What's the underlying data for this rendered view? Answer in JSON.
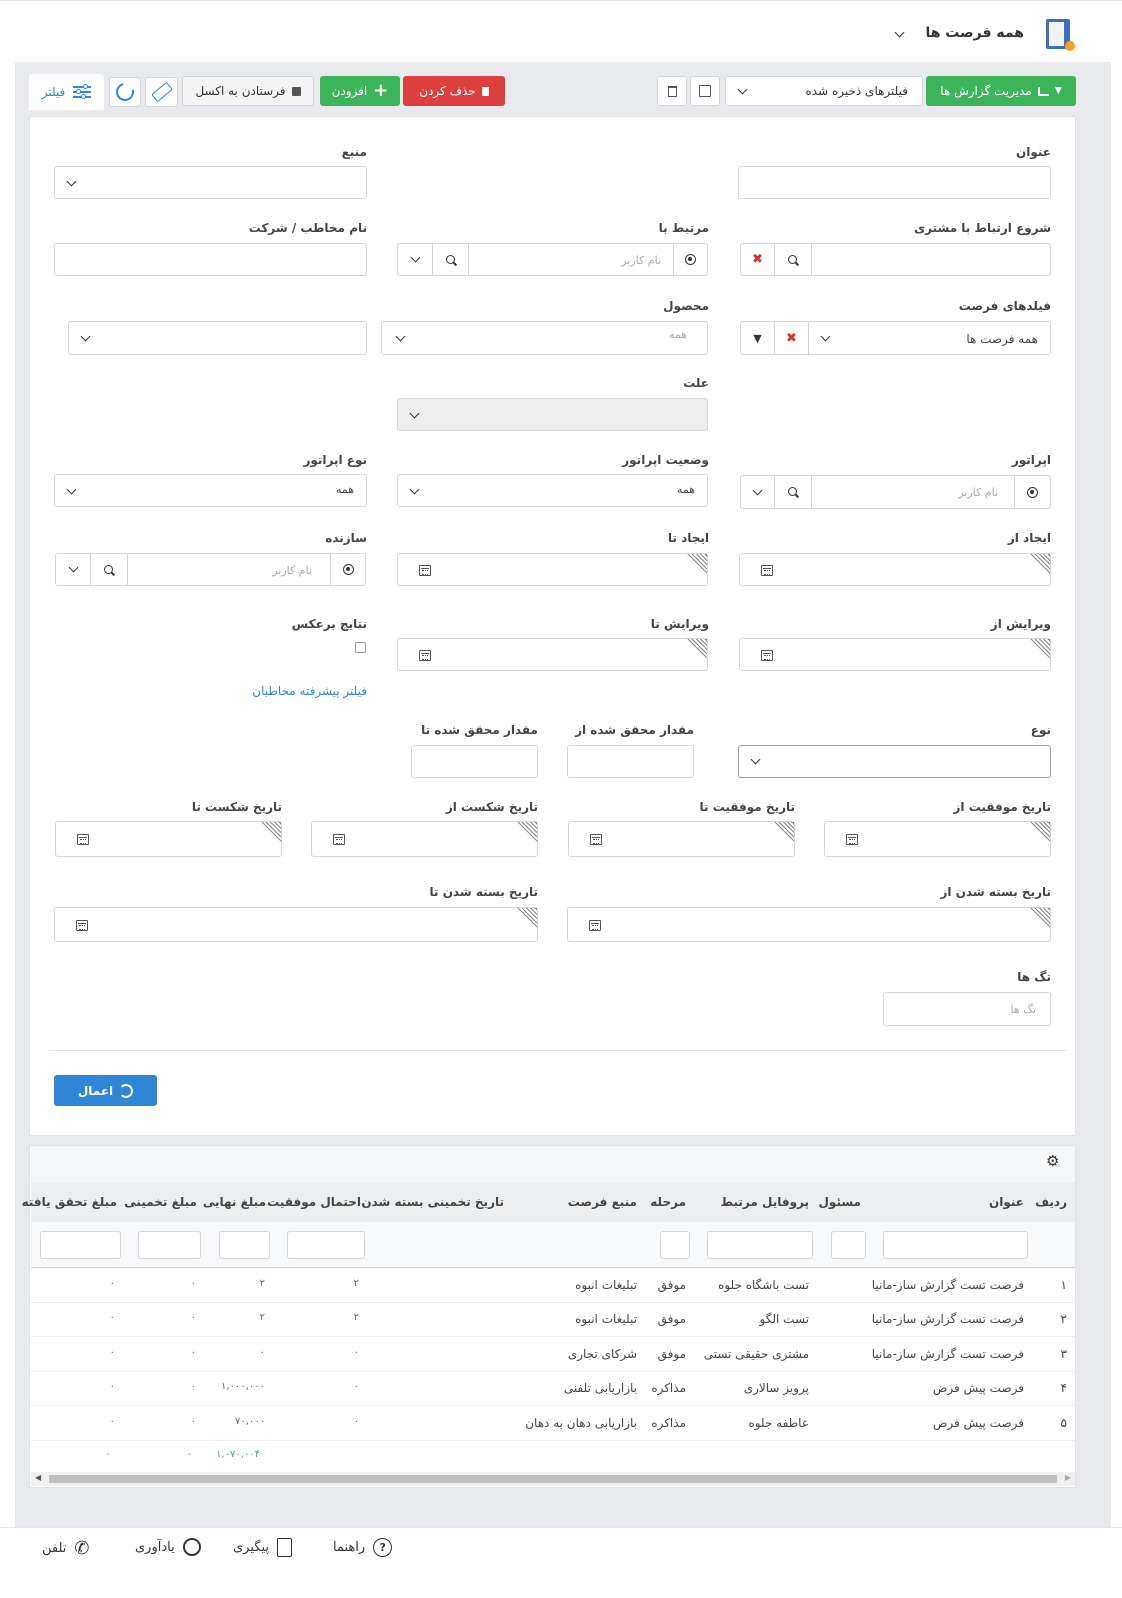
{
  "header": {
    "title": "همه فرصت ها"
  },
  "toolbar": {
    "filter_label": "فیلتر",
    "export_label": "فرستادن به اکسل",
    "add_label": "افزودن",
    "delete_label": "حذف کردن",
    "saved_filters_value": "فیلترهای ذخیره شده",
    "report_manage_label": "مدیریت گزارش ها"
  },
  "form": {
    "title_label": "عنوان",
    "source_label": "منبع",
    "contact_start_label": "شروع ارتباط با مشتری",
    "related_label": "مرتبط با",
    "related_placeholder": "نام کاربر",
    "contact_company_label": "نام مخاطب / شرکت",
    "opp_fields_label": "فیلدهای فرصت",
    "opp_fields_value": "همه فرصت ها",
    "product_label": "محصول",
    "product_value": "همه",
    "reason_label": "علت",
    "operator_label": "اپراتور",
    "operator_placeholder": "نام کاربر",
    "operator_status_label": "وضعیت اپراتور",
    "operator_status_value": "همه",
    "operator_type_label": "نوع اپراتور",
    "operator_type_value": "همه",
    "created_from_label": "ایجاد از",
    "created_to_label": "ایجاد تا",
    "creator_label": "سازنده",
    "creator_placeholder": "نام کاربر",
    "edited_from_label": "ویرایش از",
    "edited_to_label": "ویرایش تا",
    "reverse_label": "نتایج برعکس",
    "advanced_filter_link": "فیلتر پیشرفته مخاطبان",
    "type_label": "نوع",
    "achieved_from_label": "مقدار محقق شده از",
    "achieved_to_label": "مقدار محقق شده تا",
    "success_from_label": "تاریخ موفقیت از",
    "success_to_label": "تاریخ موفقیت تا",
    "fail_from_label": "تاریخ شکست از",
    "fail_to_label": "تاریخ شکست تا",
    "closed_from_label": "تاریخ بسته شدن از",
    "closed_to_label": "تاریخ بسته شدن تا",
    "tags_label": "تگ ها",
    "tags_placeholder": "تگ ها",
    "apply_label": "اعمال"
  },
  "table": {
    "columns": [
      "ردیف",
      "عنوان",
      "مسئول",
      "پروفایل مرتبط",
      "مرحله",
      "منبع فرصت",
      "تاریخ تخمینی بسته شدن",
      "احتمال موفقیت",
      "مبلغ نهایی",
      "مبلغ تخمینی",
      "مبلغ تحقق یافته"
    ],
    "rows": [
      {
        "n": "۱",
        "title": "فرصت تست گزارش ساز-مانیا",
        "owner": "",
        "profile": "تست باشگاه جلوه",
        "stage": "موفق",
        "source": "تبلیغات انبوه",
        "date": "",
        "prob": "۲",
        "final": "۲",
        "est": "۰",
        "realized": "۰"
      },
      {
        "n": "۲",
        "title": "فرصت تست گزارش ساز-مانیا",
        "owner": "",
        "profile": "تست الگو",
        "stage": "موفق",
        "source": "تبلیغات انبوه",
        "date": "",
        "prob": "۲",
        "final": "۲",
        "est": "۰",
        "realized": "۰"
      },
      {
        "n": "۳",
        "title": "فرصت تست گزارش ساز-مانیا",
        "owner": "",
        "profile": "مشتری حقیقی تستی",
        "stage": "موفق",
        "source": "شرکای تجاری",
        "date": "",
        "prob": "۰",
        "final": "۰",
        "est": "۰",
        "realized": "۰"
      },
      {
        "n": "۴",
        "title": "فرصت پیش فرض",
        "owner": "",
        "profile": "پرویز سالاری",
        "stage": "مذاکره",
        "source": "بازاریابی تلفنی",
        "date": "",
        "prob": "۰",
        "final": "۱,۰۰۰,۰۰۰",
        "est": "۰",
        "realized": "۰"
      },
      {
        "n": "۵",
        "title": "فرصت پیش فرض",
        "owner": "",
        "profile": "عاطفه جلوه",
        "stage": "مذاکره",
        "source": "بازاریابی دهان به دهان",
        "date": "",
        "prob": "۰",
        "final": "۷۰,۰۰۰",
        "est": "۰",
        "realized": "۰"
      }
    ],
    "totals": {
      "final": "۱,۰۷۰,۰۰۴",
      "est": "۰",
      "realized": "۰"
    }
  },
  "footer": {
    "help_label": "راهنما",
    "followup_label": "پیگیری",
    "reminder_label": "یادآوری",
    "phone_label": "تلفن"
  },
  "colors": {
    "green": "#3cb45a",
    "red": "#dd3f3f",
    "blue": "#2f86d6",
    "link": "#2f86d6"
  }
}
